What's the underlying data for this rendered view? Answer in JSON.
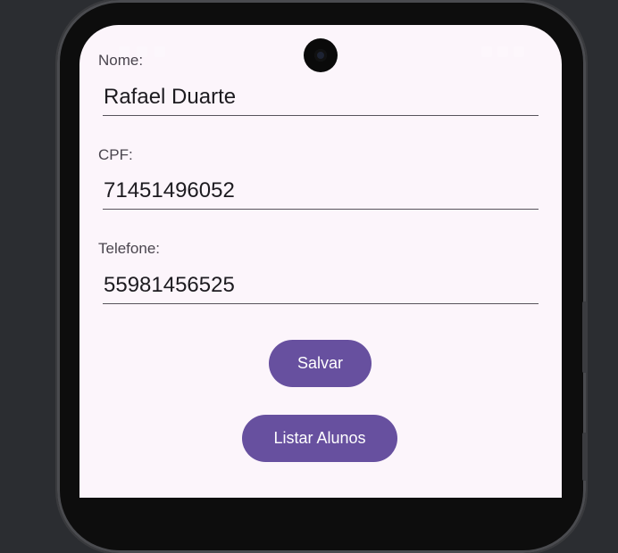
{
  "form": {
    "nome_label": "Nome:",
    "nome_value": "Rafael Duarte",
    "cpf_label": "CPF:",
    "cpf_value": "71451496052",
    "telefone_label": "Telefone:",
    "telefone_value": "55981456525"
  },
  "actions": {
    "salvar_label": "Salvar",
    "listar_label": "Listar Alunos"
  },
  "colors": {
    "primary": "#67509f",
    "surface": "#fcf5fb",
    "background": "#2b2d31"
  }
}
